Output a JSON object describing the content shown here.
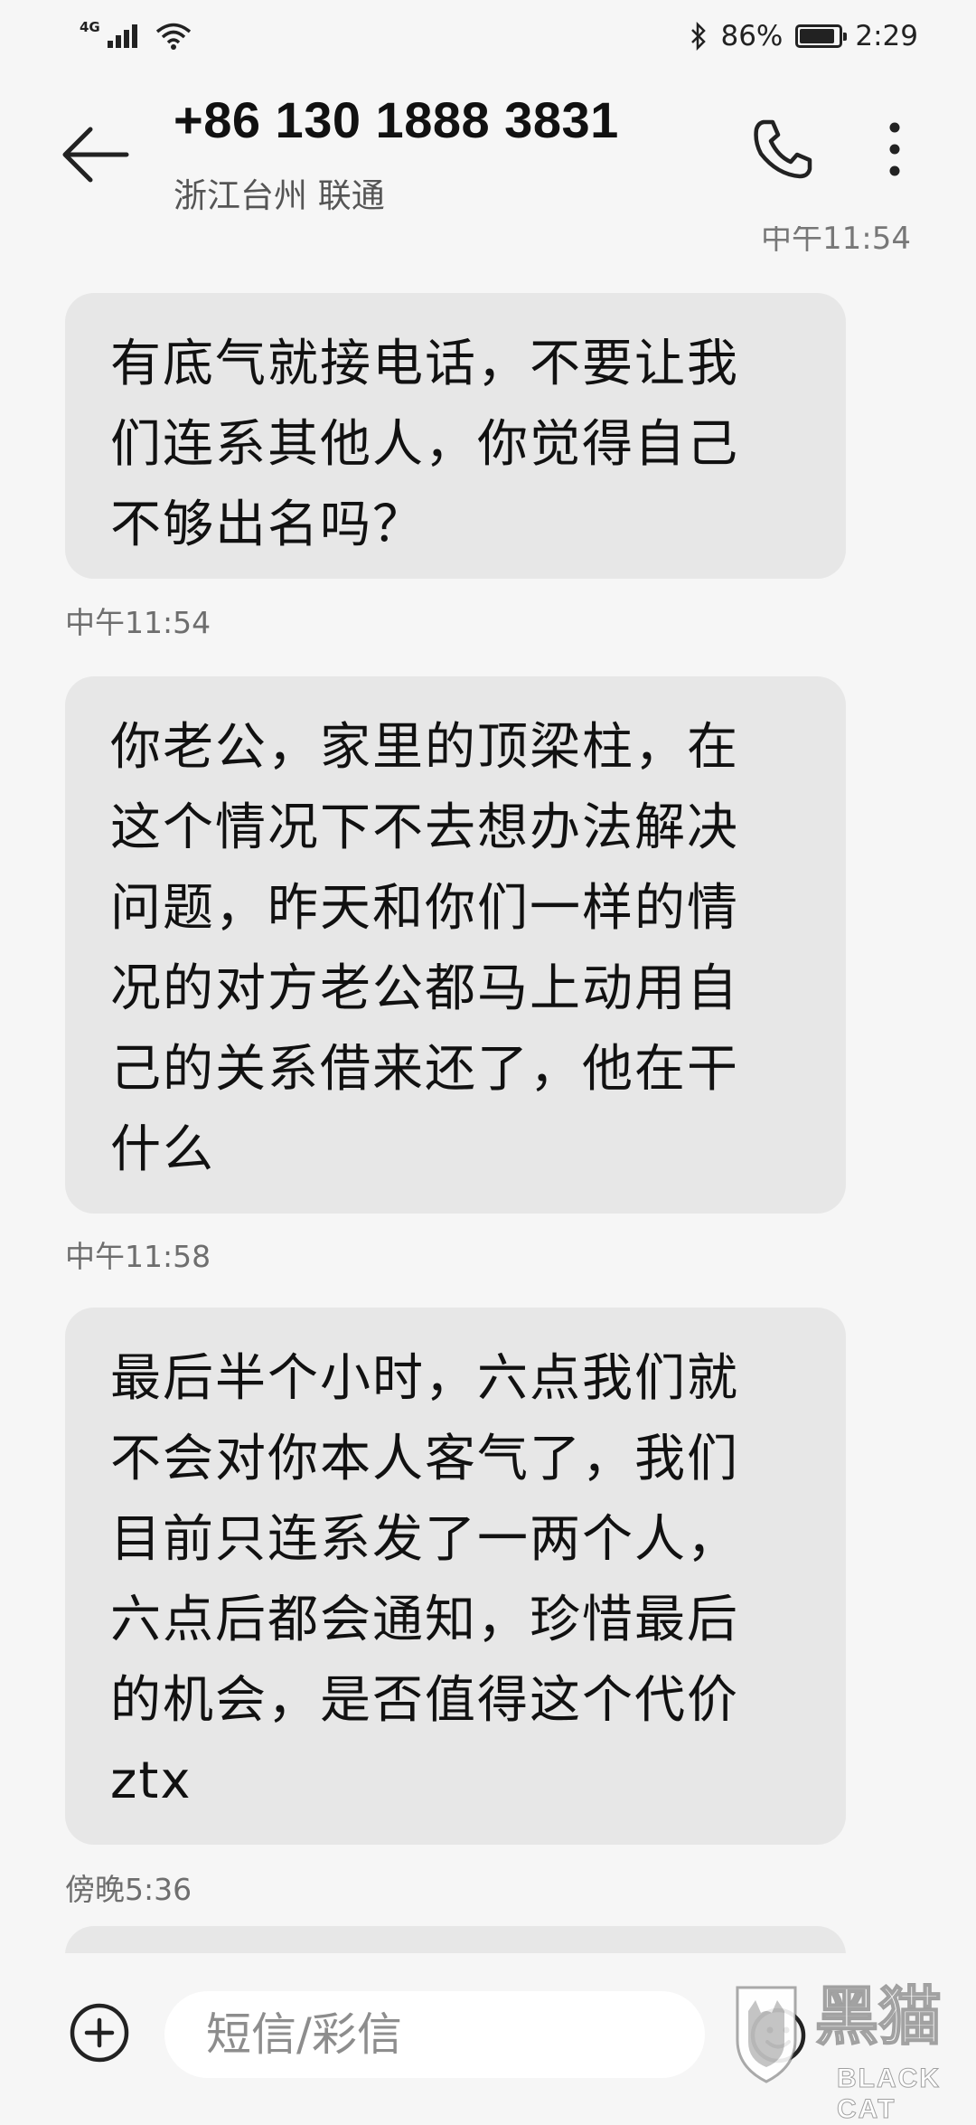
{
  "status_bar": {
    "network": "4G",
    "battery": "86%",
    "battery_level": 0.86,
    "time": "2:29"
  },
  "header": {
    "contact": "+86 130 1888 3831",
    "location": "浙江台州 联通"
  },
  "conversation": {
    "clipped_timestamp": "中午11:54",
    "messages": [
      {
        "text": "有底气就接电话，不要让我\n们连系其他人，你觉得自己\n不够出名吗？",
        "time": "中午11:54"
      },
      {
        "text": "你老公，家里的顶梁柱，在\n这个情况下不去想办法解决\n问题，昨天和你们一样的情\n况的对方老公都马上动用自\n己的关系借来还了，他在干\n什么",
        "time": "中午11:58"
      },
      {
        "text": "最后半个小时，六点我们就\n不会对你本人客气了，我们\n目前只连系发了一两个人，\n六点后都会通知，珍惜最后\n的机会，是否值得这个代价\nztx",
        "time": "傍晚5:36"
      }
    ]
  },
  "input_bar": {
    "placeholder": "短信/彩信"
  },
  "watermark": {
    "cn": "黑猫",
    "en": "BLACK CAT"
  },
  "icons": [
    "signal-icon",
    "wifi-icon",
    "bluetooth-icon",
    "battery-icon",
    "back-arrow-icon",
    "phone-icon",
    "more-vert-icon",
    "plus-circle-icon",
    "emoji-icon"
  ]
}
